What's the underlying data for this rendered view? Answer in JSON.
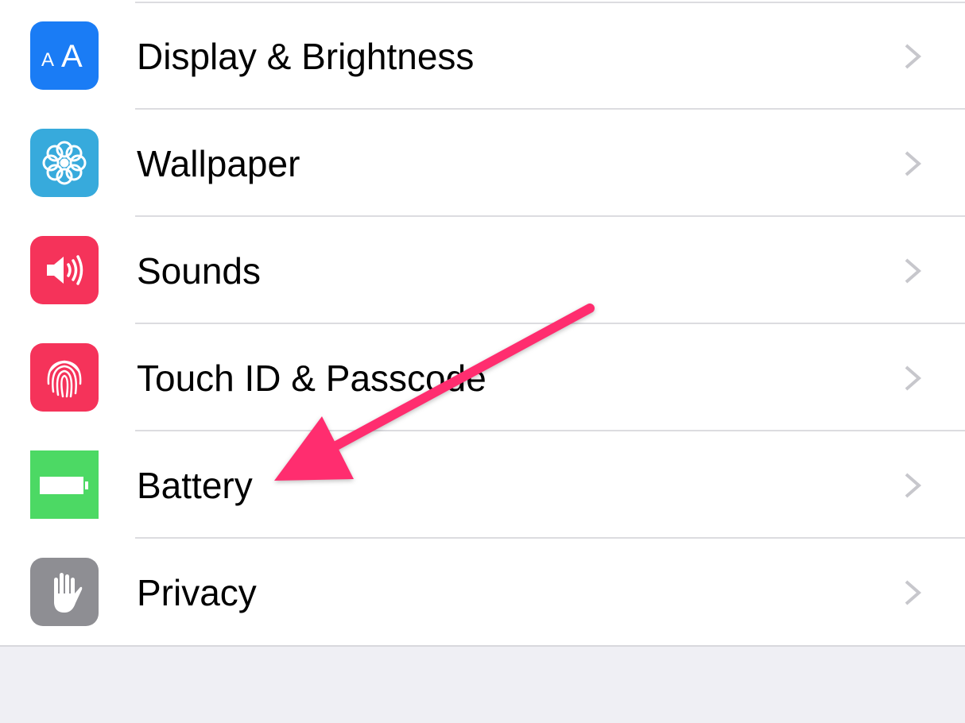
{
  "settings": {
    "items": [
      {
        "label": "Display & Brightness",
        "icon": "display-brightness-icon",
        "color": "#1a7cf5"
      },
      {
        "label": "Wallpaper",
        "icon": "wallpaper-flower-icon",
        "color": "#37aadc"
      },
      {
        "label": "Sounds",
        "icon": "speaker-icon",
        "color": "#f5335a"
      },
      {
        "label": "Touch ID & Passcode",
        "icon": "fingerprint-icon",
        "color": "#f5335a"
      },
      {
        "label": "Battery",
        "icon": "battery-icon",
        "color": "#4cd964"
      },
      {
        "label": "Privacy",
        "icon": "hand-icon",
        "color": "#8e8e93"
      }
    ]
  },
  "annotation": {
    "arrow_color": "#ff2d6f",
    "points_to": "Battery"
  },
  "icon_text": {
    "display": "AA"
  }
}
